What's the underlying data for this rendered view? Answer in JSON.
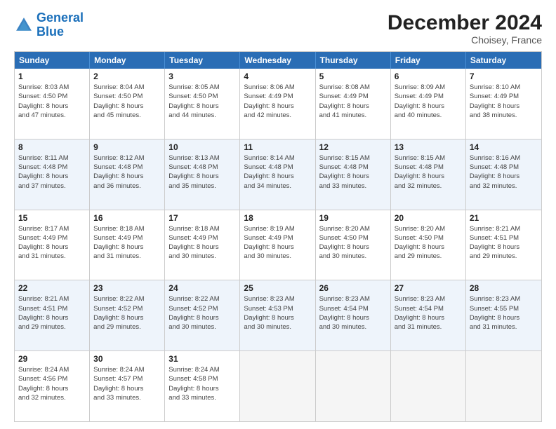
{
  "logo": {
    "text1": "General",
    "text2": "Blue"
  },
  "title": "December 2024",
  "subtitle": "Choisey, France",
  "header_days": [
    "Sunday",
    "Monday",
    "Tuesday",
    "Wednesday",
    "Thursday",
    "Friday",
    "Saturday"
  ],
  "rows": [
    {
      "alt": false,
      "cells": [
        {
          "day": "1",
          "lines": [
            "Sunrise: 8:03 AM",
            "Sunset: 4:50 PM",
            "Daylight: 8 hours",
            "and 47 minutes."
          ]
        },
        {
          "day": "2",
          "lines": [
            "Sunrise: 8:04 AM",
            "Sunset: 4:50 PM",
            "Daylight: 8 hours",
            "and 45 minutes."
          ]
        },
        {
          "day": "3",
          "lines": [
            "Sunrise: 8:05 AM",
            "Sunset: 4:50 PM",
            "Daylight: 8 hours",
            "and 44 minutes."
          ]
        },
        {
          "day": "4",
          "lines": [
            "Sunrise: 8:06 AM",
            "Sunset: 4:49 PM",
            "Daylight: 8 hours",
            "and 42 minutes."
          ]
        },
        {
          "day": "5",
          "lines": [
            "Sunrise: 8:08 AM",
            "Sunset: 4:49 PM",
            "Daylight: 8 hours",
            "and 41 minutes."
          ]
        },
        {
          "day": "6",
          "lines": [
            "Sunrise: 8:09 AM",
            "Sunset: 4:49 PM",
            "Daylight: 8 hours",
            "and 40 minutes."
          ]
        },
        {
          "day": "7",
          "lines": [
            "Sunrise: 8:10 AM",
            "Sunset: 4:49 PM",
            "Daylight: 8 hours",
            "and 38 minutes."
          ]
        }
      ]
    },
    {
      "alt": true,
      "cells": [
        {
          "day": "8",
          "lines": [
            "Sunrise: 8:11 AM",
            "Sunset: 4:48 PM",
            "Daylight: 8 hours",
            "and 37 minutes."
          ]
        },
        {
          "day": "9",
          "lines": [
            "Sunrise: 8:12 AM",
            "Sunset: 4:48 PM",
            "Daylight: 8 hours",
            "and 36 minutes."
          ]
        },
        {
          "day": "10",
          "lines": [
            "Sunrise: 8:13 AM",
            "Sunset: 4:48 PM",
            "Daylight: 8 hours",
            "and 35 minutes."
          ]
        },
        {
          "day": "11",
          "lines": [
            "Sunrise: 8:14 AM",
            "Sunset: 4:48 PM",
            "Daylight: 8 hours",
            "and 34 minutes."
          ]
        },
        {
          "day": "12",
          "lines": [
            "Sunrise: 8:15 AM",
            "Sunset: 4:48 PM",
            "Daylight: 8 hours",
            "and 33 minutes."
          ]
        },
        {
          "day": "13",
          "lines": [
            "Sunrise: 8:15 AM",
            "Sunset: 4:48 PM",
            "Daylight: 8 hours",
            "and 32 minutes."
          ]
        },
        {
          "day": "14",
          "lines": [
            "Sunrise: 8:16 AM",
            "Sunset: 4:48 PM",
            "Daylight: 8 hours",
            "and 32 minutes."
          ]
        }
      ]
    },
    {
      "alt": false,
      "cells": [
        {
          "day": "15",
          "lines": [
            "Sunrise: 8:17 AM",
            "Sunset: 4:49 PM",
            "Daylight: 8 hours",
            "and 31 minutes."
          ]
        },
        {
          "day": "16",
          "lines": [
            "Sunrise: 8:18 AM",
            "Sunset: 4:49 PM",
            "Daylight: 8 hours",
            "and 31 minutes."
          ]
        },
        {
          "day": "17",
          "lines": [
            "Sunrise: 8:18 AM",
            "Sunset: 4:49 PM",
            "Daylight: 8 hours",
            "and 30 minutes."
          ]
        },
        {
          "day": "18",
          "lines": [
            "Sunrise: 8:19 AM",
            "Sunset: 4:49 PM",
            "Daylight: 8 hours",
            "and 30 minutes."
          ]
        },
        {
          "day": "19",
          "lines": [
            "Sunrise: 8:20 AM",
            "Sunset: 4:50 PM",
            "Daylight: 8 hours",
            "and 30 minutes."
          ]
        },
        {
          "day": "20",
          "lines": [
            "Sunrise: 8:20 AM",
            "Sunset: 4:50 PM",
            "Daylight: 8 hours",
            "and 29 minutes."
          ]
        },
        {
          "day": "21",
          "lines": [
            "Sunrise: 8:21 AM",
            "Sunset: 4:51 PM",
            "Daylight: 8 hours",
            "and 29 minutes."
          ]
        }
      ]
    },
    {
      "alt": true,
      "cells": [
        {
          "day": "22",
          "lines": [
            "Sunrise: 8:21 AM",
            "Sunset: 4:51 PM",
            "Daylight: 8 hours",
            "and 29 minutes."
          ]
        },
        {
          "day": "23",
          "lines": [
            "Sunrise: 8:22 AM",
            "Sunset: 4:52 PM",
            "Daylight: 8 hours",
            "and 29 minutes."
          ]
        },
        {
          "day": "24",
          "lines": [
            "Sunrise: 8:22 AM",
            "Sunset: 4:52 PM",
            "Daylight: 8 hours",
            "and 30 minutes."
          ]
        },
        {
          "day": "25",
          "lines": [
            "Sunrise: 8:23 AM",
            "Sunset: 4:53 PM",
            "Daylight: 8 hours",
            "and 30 minutes."
          ]
        },
        {
          "day": "26",
          "lines": [
            "Sunrise: 8:23 AM",
            "Sunset: 4:54 PM",
            "Daylight: 8 hours",
            "and 30 minutes."
          ]
        },
        {
          "day": "27",
          "lines": [
            "Sunrise: 8:23 AM",
            "Sunset: 4:54 PM",
            "Daylight: 8 hours",
            "and 31 minutes."
          ]
        },
        {
          "day": "28",
          "lines": [
            "Sunrise: 8:23 AM",
            "Sunset: 4:55 PM",
            "Daylight: 8 hours",
            "and 31 minutes."
          ]
        }
      ]
    },
    {
      "alt": false,
      "cells": [
        {
          "day": "29",
          "lines": [
            "Sunrise: 8:24 AM",
            "Sunset: 4:56 PM",
            "Daylight: 8 hours",
            "and 32 minutes."
          ]
        },
        {
          "day": "30",
          "lines": [
            "Sunrise: 8:24 AM",
            "Sunset: 4:57 PM",
            "Daylight: 8 hours",
            "and 33 minutes."
          ]
        },
        {
          "day": "31",
          "lines": [
            "Sunrise: 8:24 AM",
            "Sunset: 4:58 PM",
            "Daylight: 8 hours",
            "and 33 minutes."
          ]
        },
        {
          "day": "",
          "lines": []
        },
        {
          "day": "",
          "lines": []
        },
        {
          "day": "",
          "lines": []
        },
        {
          "day": "",
          "lines": []
        }
      ]
    }
  ]
}
